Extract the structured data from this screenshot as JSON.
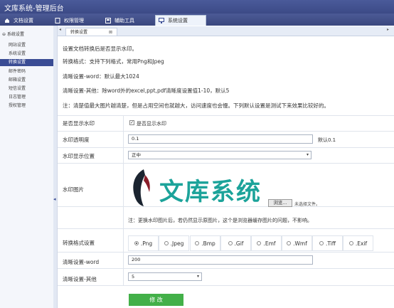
{
  "app": {
    "title": "文库系统-管理后台"
  },
  "topnav": [
    {
      "label": "文档设置",
      "icon": "home-icon"
    },
    {
      "label": "权限管理",
      "icon": "document-icon"
    },
    {
      "label": "辅助工具",
      "icon": "tool-icon"
    },
    {
      "label": "系统设置",
      "icon": "monitor-icon"
    }
  ],
  "sidebar": {
    "heading": "系统设置",
    "items": [
      "网站设置",
      "系统设置",
      "转换设置",
      "邮件密码",
      "邮箱设置",
      "短信设置",
      "日志管理",
      "授权管理"
    ]
  },
  "page_tab": {
    "label": "转换设置"
  },
  "notes": [
    "设置文档转换后是否显示水印。",
    "转换格式：支持下列格式，常用Png和Jpeg",
    "清晰设置-word：默认最大1024",
    "清晰设置-其他：除word外的excel,ppt,pdf清晰度设置值1-10，默认5",
    "注：清楚值最大图片越清楚，但是占用空间也就越大，访问速度也会慢。下列默认设置是测试下来效果比较好的。"
  ],
  "form": {
    "watermark_show_label": "是否显示水印",
    "watermark_show_checkbox": "是否显示水印",
    "opacity_label": "水印透明度",
    "opacity_value": "0.1",
    "opacity_hint": "默认0.1",
    "position_label": "水印显示位置",
    "position_value": "正中",
    "image_label": "水印图片",
    "logo_text": "文库系统",
    "browse_label": "浏览...",
    "file_status": "未选择文件。",
    "image_note": "注：更换水印图片后，若仍然显示原图片，这个是浏览器缓存图片的问题，不影响。",
    "format_label": "转换格式设置",
    "formats": [
      ".Png",
      ".Jpeg",
      ".Bmp",
      ".Gif",
      ".Emf",
      ".Wmf",
      ".Tiff",
      ".Exif"
    ],
    "selected_format": ".Png",
    "word_label": "清晰设置-word",
    "word_value": "200",
    "other_label": "清晰设置-其他",
    "other_value": "5",
    "submit_label": "修 改"
  },
  "colors": {
    "accent": "#3a4c94",
    "logo": "#1ca39a",
    "submit": "#43b049"
  }
}
